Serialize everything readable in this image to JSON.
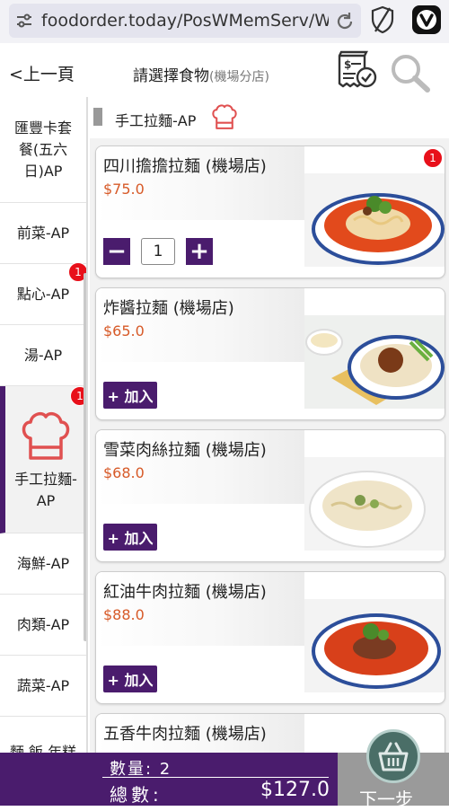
{
  "browser": {
    "url": "foodorder.today/PosWMemServ/WM"
  },
  "header": {
    "back_label": "上一頁",
    "title": "請選擇食物",
    "subtitle": "(機場分店)"
  },
  "sidebar": {
    "items": [
      {
        "label": "匯豐卡套餐(五六日)AP"
      },
      {
        "label": "前菜-AP"
      },
      {
        "label": "點心-AP",
        "badge": "1"
      },
      {
        "label": "湯-AP"
      },
      {
        "label": "手工拉麵-AP",
        "badge": "1"
      },
      {
        "label": "海鮮-AP"
      },
      {
        "label": "肉類-AP"
      },
      {
        "label": "蔬菜-AP"
      },
      {
        "label": "麵.飯.年糕"
      }
    ]
  },
  "section": {
    "title": "手工拉麵-AP"
  },
  "menu": {
    "add_label": "+ 加入",
    "items": [
      {
        "name": "四川擔擔拉麵 (機場店)",
        "price": "$75.0",
        "quantity": "1",
        "badge": "1"
      },
      {
        "name": "炸醬拉麵 (機場店)",
        "price": "$65.0"
      },
      {
        "name": "雪菜肉絲拉麵 (機場店)",
        "price": "$68.0"
      },
      {
        "name": "紅油牛肉拉麵 (機場店)",
        "price": "$88.0"
      },
      {
        "name": "五香牛肉拉麵 (機場店)"
      }
    ]
  },
  "footer": {
    "quantity_label": "數量: 2",
    "total_label": "總數:",
    "total_value": "$127.0",
    "next_label": "下一步"
  },
  "colors": {
    "brand_purple": "#4a1c6d",
    "price_orange": "#d75a28",
    "badge_red": "#e8101a"
  }
}
